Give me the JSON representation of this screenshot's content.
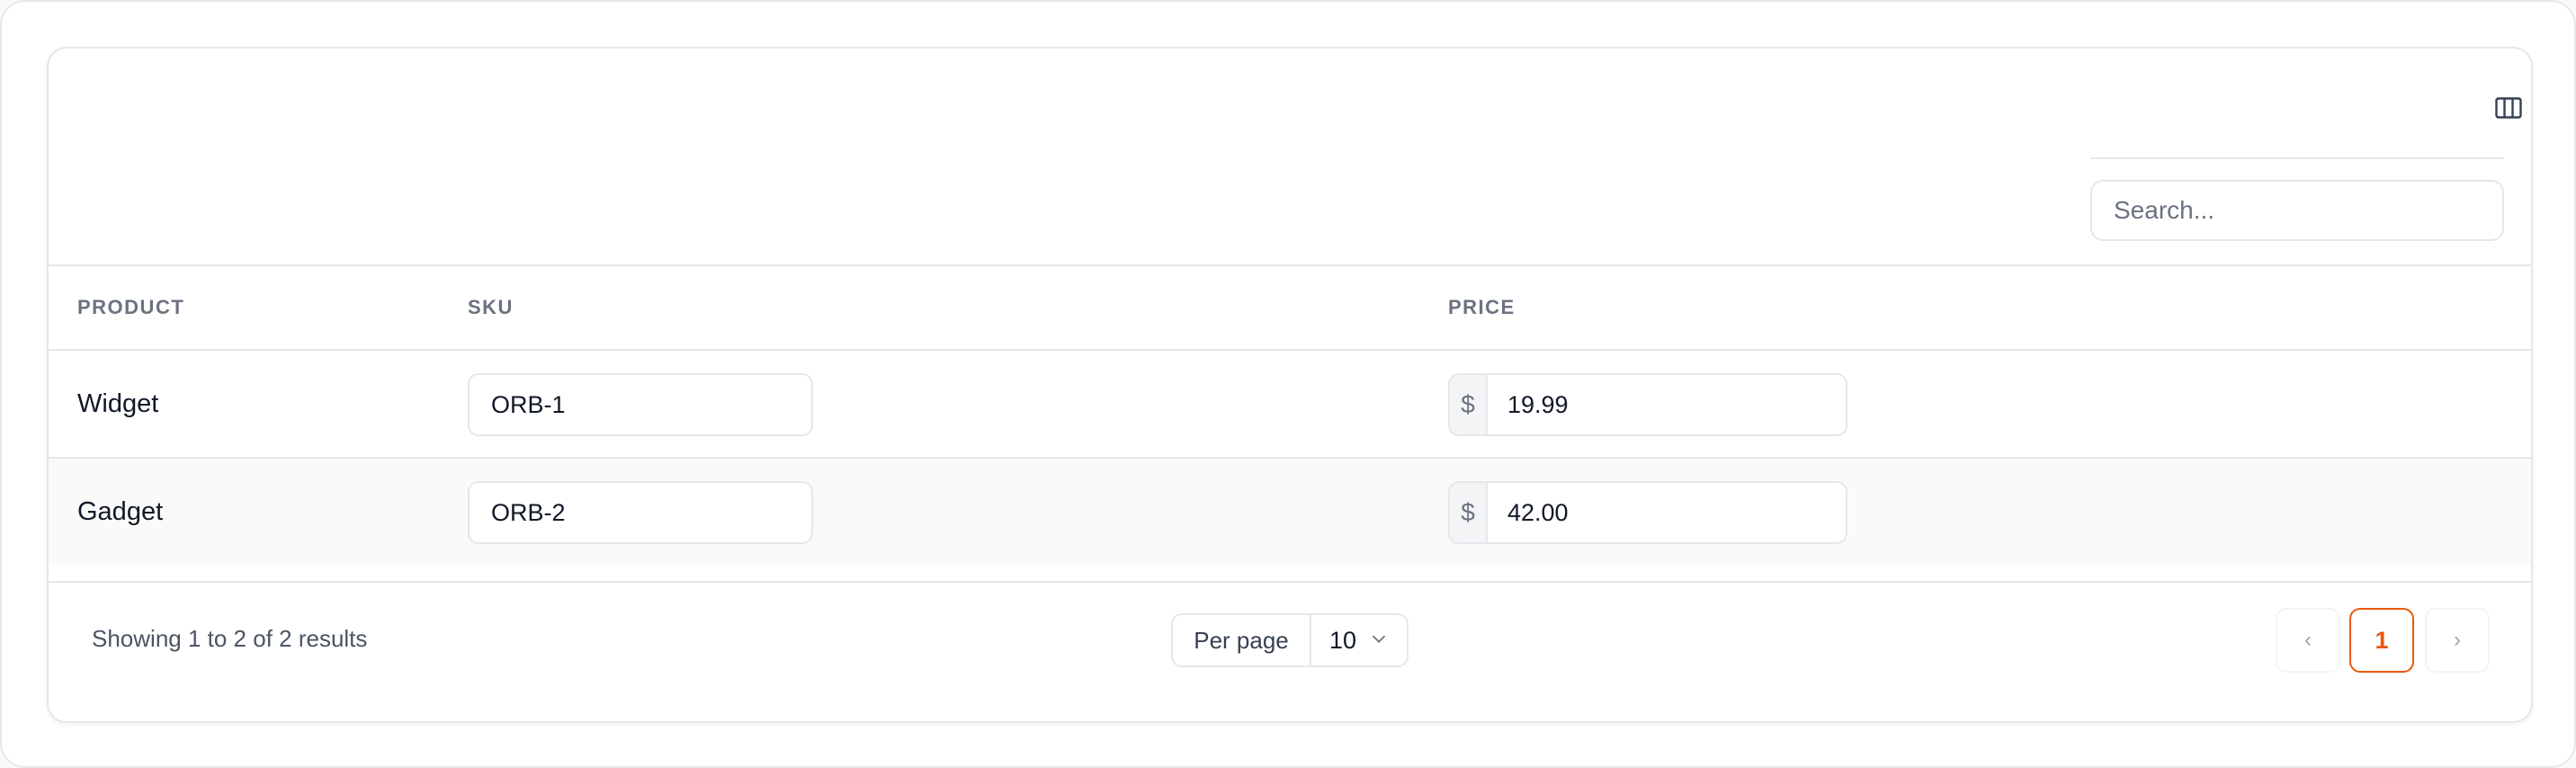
{
  "toolbar": {
    "columns_icon": "columns-icon",
    "search_placeholder": "Search..."
  },
  "table": {
    "columns": [
      "PRODUCT",
      "SKU",
      "PRICE"
    ],
    "currency_symbol": "$",
    "rows": [
      {
        "product": "Widget",
        "sku": "ORB-1",
        "price": "19.99"
      },
      {
        "product": "Gadget",
        "sku": "ORB-2",
        "price": "42.00"
      }
    ]
  },
  "footer": {
    "summary": "Showing 1 to 2 of 2 results",
    "per_page_label": "Per page",
    "per_page_value": "10",
    "pagination": {
      "prev": "‹",
      "current": "1",
      "next": "›"
    }
  },
  "colors": {
    "accent": "#ea580c",
    "border": "#e5e7eb",
    "muted": "#6b7280"
  }
}
